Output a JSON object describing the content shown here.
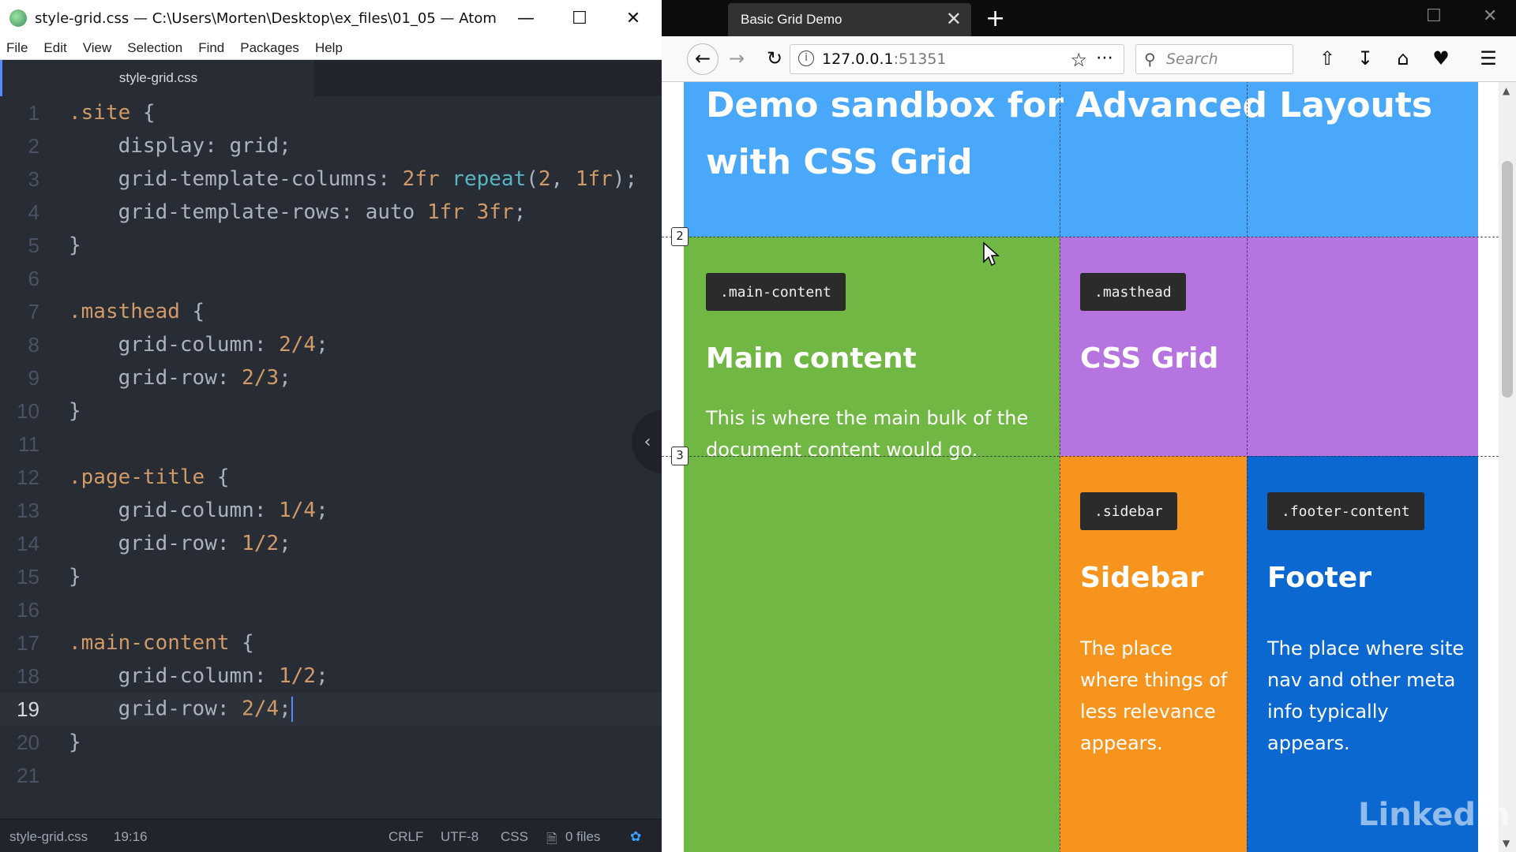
{
  "atom": {
    "title": "style-grid.css — C:\\Users\\Morten\\Desktop\\ex_files\\01_05 — Atom",
    "window_controls": [
      "minimize",
      "maximize",
      "close"
    ],
    "menu": [
      "File",
      "Edit",
      "View",
      "Selection",
      "Find",
      "Packages",
      "Help"
    ],
    "tab": "style-grid.css",
    "code_lines": [
      ".site {",
      "    display: grid;",
      "    grid-template-columns: 2fr repeat(2, 1fr);",
      "    grid-template-rows: auto 1fr 3fr;",
      "}",
      "",
      ".masthead {",
      "    grid-column: 2/4;",
      "    grid-row: 2/3;",
      "}",
      "",
      ".page-title {",
      "    grid-column: 1/4;",
      "    grid-row: 1/2;",
      "}",
      "",
      ".main-content {",
      "    grid-column: 1/2;",
      "    grid-row: 2/4;",
      "}",
      ""
    ],
    "current_line": 19,
    "status": {
      "file": "style-grid.css",
      "cursor": "19:16",
      "line_ending": "CRLF",
      "encoding": "UTF-8",
      "grammar": "CSS",
      "files": "0 files"
    }
  },
  "browser": {
    "tab_title": "Basic Grid Demo",
    "url_host": "127.0.0.1",
    "url_port": ":51351",
    "search_placeholder": "Search",
    "page": {
      "title_line1": "Demo sandbox for Advanced Layouts",
      "title_line2": "with CSS Grid",
      "main_tag": ".main-content",
      "main_heading": "Main content",
      "main_text_1": "This is where the main bulk of the",
      "main_text_2": "document content would go.",
      "masthead_tag": ".masthead",
      "masthead_heading": "CSS Grid",
      "sidebar_tag": ".sidebar",
      "sidebar_heading": "Sidebar",
      "sidebar_text": [
        "The place",
        "where things of",
        "less relevance",
        "appears."
      ],
      "footer_tag": ".footer-content",
      "footer_heading": "Footer",
      "footer_text": [
        "The place where site",
        "nav and other meta",
        "info typically",
        "appears."
      ],
      "grid_line_labels": [
        "2",
        "3"
      ]
    },
    "colors": {
      "title_bg": "#4aa8fa",
      "main_bg": "#70b843",
      "masthead_bg": "#b674e0",
      "sidebar_bg": "#f7941d",
      "footer_bg": "#0b68d0"
    }
  },
  "watermark": "LinkedIn"
}
